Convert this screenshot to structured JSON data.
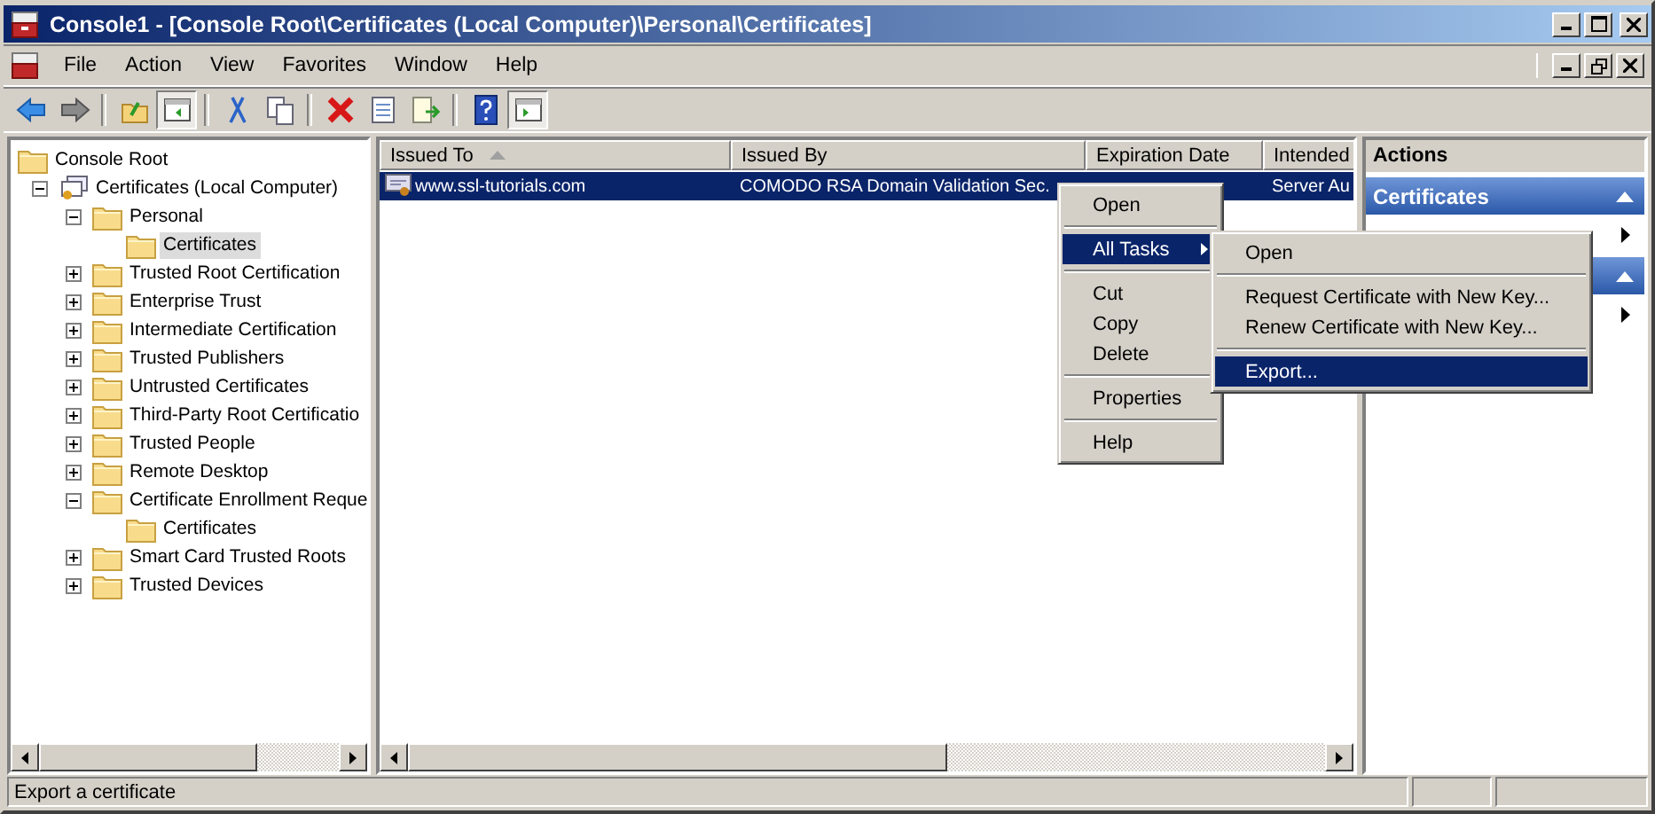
{
  "window": {
    "title": "Console1 - [Console Root\\Certificates (Local Computer)\\Personal\\Certificates]"
  },
  "menu": [
    "File",
    "Action",
    "View",
    "Favorites",
    "Window",
    "Help"
  ],
  "toolbar": [
    {
      "kind": "button",
      "pressed": false
    },
    {
      "kind": "button",
      "pressed": false
    },
    {
      "kind": "separator"
    },
    {
      "kind": "button",
      "pressed": false
    },
    {
      "kind": "button",
      "pressed": true
    },
    {
      "kind": "separator"
    },
    {
      "kind": "button",
      "pressed": false
    },
    {
      "kind": "button",
      "pressed": false
    },
    {
      "kind": "separator"
    },
    {
      "kind": "button",
      "pressed": false
    },
    {
      "kind": "button",
      "pressed": false
    },
    {
      "kind": "button",
      "pressed": false
    },
    {
      "kind": "separator"
    },
    {
      "kind": "button",
      "pressed": false
    },
    {
      "kind": "button",
      "pressed": true
    }
  ],
  "tree": [
    {
      "label": "Console Root",
      "kind": "folder",
      "selected": false,
      "children": [
        {
          "label": "Certificates (Local Computer)",
          "kind": "store",
          "expanded": true,
          "selected": false,
          "children": [
            {
              "label": "Personal",
              "kind": "folder",
              "expanded": true,
              "selected": false,
              "children": [
                {
                  "label": "Certificates",
                  "kind": "folder",
                  "selected": true
                }
              ]
            },
            {
              "label": "Trusted Root Certification",
              "kind": "folder",
              "expanded": false,
              "selected": false
            },
            {
              "label": "Enterprise Trust",
              "kind": "folder",
              "expanded": false,
              "selected": false
            },
            {
              "label": "Intermediate Certification",
              "kind": "folder",
              "expanded": false,
              "selected": false
            },
            {
              "label": "Trusted Publishers",
              "kind": "folder",
              "expanded": false,
              "selected": false
            },
            {
              "label": "Untrusted Certificates",
              "kind": "folder",
              "expanded": false,
              "selected": false
            },
            {
              "label": "Third-Party Root Certificatio",
              "kind": "folder",
              "expanded": false,
              "selected": false
            },
            {
              "label": "Trusted People",
              "kind": "folder",
              "expanded": false,
              "selected": false
            },
            {
              "label": "Remote Desktop",
              "kind": "folder",
              "expanded": false,
              "selected": false
            },
            {
              "label": "Certificate Enrollment Reque",
              "kind": "folder",
              "expanded": true,
              "selected": false,
              "children": [
                {
                  "label": "Certificates",
                  "kind": "folder",
                  "selected": false
                }
              ]
            },
            {
              "label": "Smart Card Trusted Roots",
              "kind": "folder",
              "expanded": false,
              "selected": false
            },
            {
              "label": "Trusted Devices",
              "kind": "folder",
              "expanded": false,
              "selected": false
            }
          ]
        }
      ]
    }
  ],
  "table": {
    "columns": [
      {
        "label": "Issued To",
        "sorted": true
      },
      {
        "label": "Issued By"
      },
      {
        "label": "Expiration Date"
      },
      {
        "label": "Intended"
      }
    ],
    "rows": [
      {
        "selected": true,
        "issued_to": "www.ssl-tutorials.com",
        "issued_by": "COMODO RSA Domain Validation Sec.",
        "intended": "Server Au"
      }
    ]
  },
  "actions": {
    "title": "Actions",
    "sections": [
      {
        "title": "Certificates",
        "expanded": true,
        "items": [
          {
            "kind": "submenu"
          }
        ]
      },
      {
        "expanded": true,
        "items": [
          {
            "kind": "submenu"
          }
        ]
      }
    ]
  },
  "context_menu": {
    "items": [
      {
        "kind": "item",
        "label": "Open",
        "selected": false
      },
      {
        "kind": "separator"
      },
      {
        "kind": "submenu",
        "label": "All Tasks",
        "selected": true
      },
      {
        "kind": "separator"
      },
      {
        "kind": "item",
        "label": "Cut",
        "selected": false
      },
      {
        "kind": "item",
        "label": "Copy",
        "selected": false
      },
      {
        "kind": "item",
        "label": "Delete",
        "selected": false
      },
      {
        "kind": "separator"
      },
      {
        "kind": "item",
        "label": "Properties",
        "selected": false
      },
      {
        "kind": "separator"
      },
      {
        "kind": "item",
        "label": "Help",
        "selected": false
      }
    ]
  },
  "submenu": {
    "items": [
      {
        "kind": "item",
        "label": "Open",
        "selected": false
      },
      {
        "kind": "separator"
      },
      {
        "kind": "item",
        "label": "Request Certificate with New Key...",
        "selected": false
      },
      {
        "kind": "item",
        "label": "Renew Certificate with New Key...",
        "selected": false
      },
      {
        "kind": "separator"
      },
      {
        "kind": "item",
        "label": "Export...",
        "selected": true
      }
    ]
  },
  "status_bar": {
    "text": "Export a certificate"
  }
}
